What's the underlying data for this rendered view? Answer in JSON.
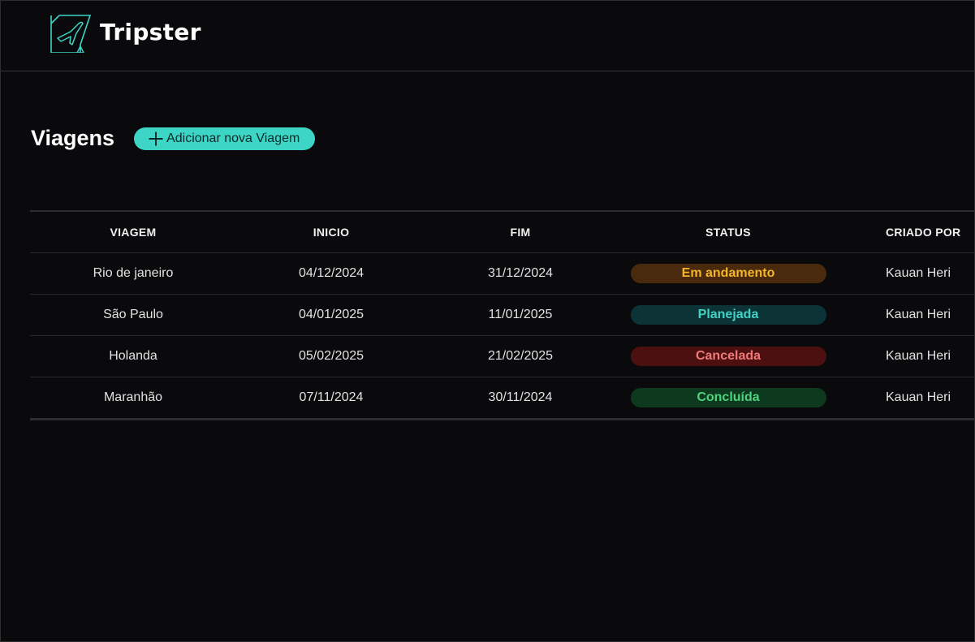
{
  "app": {
    "brand_name": "Tripster",
    "logo_icon": "plane-logo-icon"
  },
  "page": {
    "title": "Viagens",
    "add_button_label": "Adicionar nova Viagem",
    "add_button_icon": "plus-icon"
  },
  "table": {
    "columns": [
      "VIAGEM",
      "INICIO",
      "FIM",
      "STATUS",
      "CRIADO POR"
    ],
    "rows": [
      {
        "viagem": "Rio de janeiro",
        "inicio": "04/12/2024",
        "fim": "31/12/2024",
        "status": "Em andamento",
        "status_kind": "in-progress",
        "criado_por": "Kauan Heri"
      },
      {
        "viagem": "São Paulo",
        "inicio": "04/01/2025",
        "fim": "11/01/2025",
        "status": "Planejada",
        "status_kind": "planned",
        "criado_por": "Kauan Heri"
      },
      {
        "viagem": "Holanda",
        "inicio": "05/02/2025",
        "fim": "21/02/2025",
        "status": "Cancelada",
        "status_kind": "cancelled",
        "criado_por": "Kauan Heri"
      },
      {
        "viagem": "Maranhão",
        "inicio": "07/11/2024",
        "fim": "30/11/2024",
        "status": "Concluída",
        "status_kind": "completed",
        "criado_por": "Kauan Heri"
      }
    ]
  },
  "colors": {
    "background": "#0a0a0c",
    "accent": "#3dd6c6",
    "status": {
      "in-progress": {
        "bg": "#4a2a0c",
        "text": "#f5b52a"
      },
      "planned": {
        "bg": "#0c3436",
        "text": "#3fd3c6"
      },
      "cancelled": {
        "bg": "#4c1010",
        "text": "#f07a7a"
      },
      "completed": {
        "bg": "#0d3a1e",
        "text": "#4fd37c"
      }
    }
  }
}
